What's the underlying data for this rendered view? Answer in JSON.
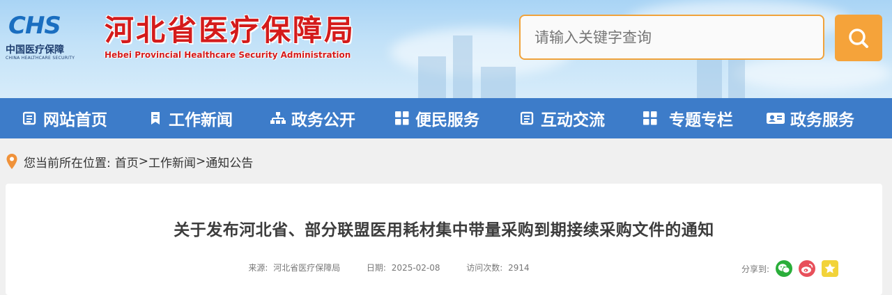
{
  "header": {
    "logo_mark": "CHS",
    "logo_cn": "中国医疗保障",
    "logo_en": "CHINA HEALTHCARE SECURITY",
    "title_cn": "河北省医疗保障局",
    "title_en": "Hebei Provincial Healthcare Security Administration"
  },
  "search": {
    "placeholder": "请输入关键字查询"
  },
  "nav": {
    "items": [
      {
        "label": "网站首页",
        "icon": "list-icon"
      },
      {
        "label": "工作新闻",
        "icon": "bookmark-icon"
      },
      {
        "label": "政务公开",
        "icon": "sitemap-icon"
      },
      {
        "label": "便民服务",
        "icon": "grid-icon"
      },
      {
        "label": "互动交流",
        "icon": "list-icon"
      },
      {
        "label": "专题专栏",
        "icon": "grid-icon"
      },
      {
        "label": "政务服务",
        "icon": "id-card-icon"
      }
    ]
  },
  "breadcrumb": {
    "prefix": "您当前所在位置:",
    "home": "首页",
    "news": "工作新闻",
    "current": "通知公告",
    "sep": ">"
  },
  "article": {
    "title": "关于发布河北省、部分联盟医用耗材集中带量采购到期接续采购文件的通知",
    "source_label": "来源:",
    "source": "河北省医疗保障局",
    "date_label": "日期:",
    "date": "2025-02-08",
    "visits_label": "访问次数:",
    "visits": "2914"
  },
  "share": {
    "label": "分享到:",
    "icons": [
      "wechat-icon",
      "weibo-icon",
      "qzone-icon"
    ]
  },
  "colors": {
    "nav_bg": "#3d7cc9",
    "accent_orange": "#f5a33a",
    "title_red": "#d41b1b",
    "logo_blue": "#1a6ec0"
  }
}
